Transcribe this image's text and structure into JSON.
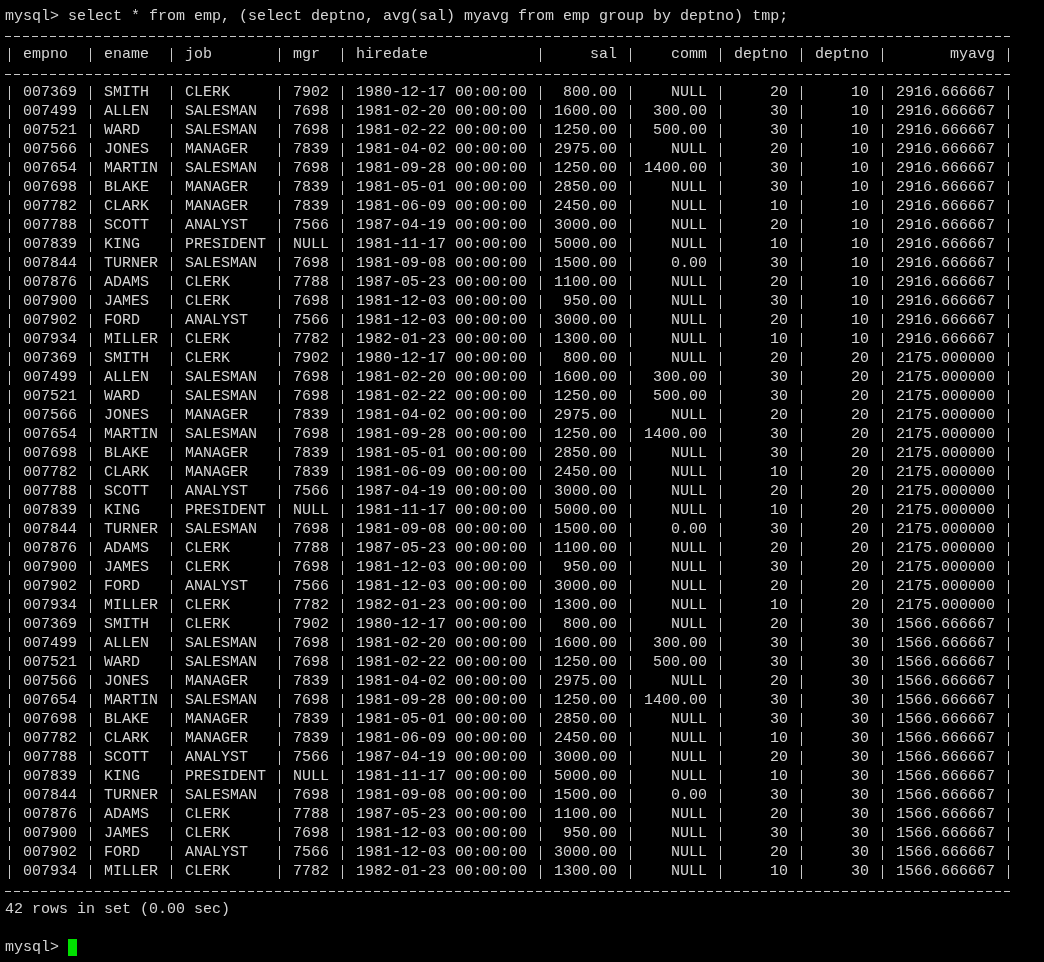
{
  "command": {
    "prompt": "mysql>",
    "text": "select * from emp, (select deptno, avg(sal) myavg from emp group by deptno) tmp;"
  },
  "table": {
    "columns": [
      {
        "label": "empno"
      },
      {
        "label": "ename"
      },
      {
        "label": "job"
      },
      {
        "label": "mgr"
      },
      {
        "label": "hiredate"
      },
      {
        "label": "sal"
      },
      {
        "label": "comm"
      },
      {
        "label": "deptno"
      },
      {
        "label": "deptno"
      },
      {
        "label": "myavg"
      }
    ],
    "rows": [
      [
        "007369",
        "SMITH",
        "CLERK",
        "7902",
        "1980-12-17 00:00:00",
        "800.00",
        "NULL",
        "20",
        "10",
        "2916.666667"
      ],
      [
        "007499",
        "ALLEN",
        "SALESMAN",
        "7698",
        "1981-02-20 00:00:00",
        "1600.00",
        "300.00",
        "30",
        "10",
        "2916.666667"
      ],
      [
        "007521",
        "WARD",
        "SALESMAN",
        "7698",
        "1981-02-22 00:00:00",
        "1250.00",
        "500.00",
        "30",
        "10",
        "2916.666667"
      ],
      [
        "007566",
        "JONES",
        "MANAGER",
        "7839",
        "1981-04-02 00:00:00",
        "2975.00",
        "NULL",
        "20",
        "10",
        "2916.666667"
      ],
      [
        "007654",
        "MARTIN",
        "SALESMAN",
        "7698",
        "1981-09-28 00:00:00",
        "1250.00",
        "1400.00",
        "30",
        "10",
        "2916.666667"
      ],
      [
        "007698",
        "BLAKE",
        "MANAGER",
        "7839",
        "1981-05-01 00:00:00",
        "2850.00",
        "NULL",
        "30",
        "10",
        "2916.666667"
      ],
      [
        "007782",
        "CLARK",
        "MANAGER",
        "7839",
        "1981-06-09 00:00:00",
        "2450.00",
        "NULL",
        "10",
        "10",
        "2916.666667"
      ],
      [
        "007788",
        "SCOTT",
        "ANALYST",
        "7566",
        "1987-04-19 00:00:00",
        "3000.00",
        "NULL",
        "20",
        "10",
        "2916.666667"
      ],
      [
        "007839",
        "KING",
        "PRESIDENT",
        "NULL",
        "1981-11-17 00:00:00",
        "5000.00",
        "NULL",
        "10",
        "10",
        "2916.666667"
      ],
      [
        "007844",
        "TURNER",
        "SALESMAN",
        "7698",
        "1981-09-08 00:00:00",
        "1500.00",
        "0.00",
        "30",
        "10",
        "2916.666667"
      ],
      [
        "007876",
        "ADAMS",
        "CLERK",
        "7788",
        "1987-05-23 00:00:00",
        "1100.00",
        "NULL",
        "20",
        "10",
        "2916.666667"
      ],
      [
        "007900",
        "JAMES",
        "CLERK",
        "7698",
        "1981-12-03 00:00:00",
        "950.00",
        "NULL",
        "30",
        "10",
        "2916.666667"
      ],
      [
        "007902",
        "FORD",
        "ANALYST",
        "7566",
        "1981-12-03 00:00:00",
        "3000.00",
        "NULL",
        "20",
        "10",
        "2916.666667"
      ],
      [
        "007934",
        "MILLER",
        "CLERK",
        "7782",
        "1982-01-23 00:00:00",
        "1300.00",
        "NULL",
        "10",
        "10",
        "2916.666667"
      ],
      [
        "007369",
        "SMITH",
        "CLERK",
        "7902",
        "1980-12-17 00:00:00",
        "800.00",
        "NULL",
        "20",
        "20",
        "2175.000000"
      ],
      [
        "007499",
        "ALLEN",
        "SALESMAN",
        "7698",
        "1981-02-20 00:00:00",
        "1600.00",
        "300.00",
        "30",
        "20",
        "2175.000000"
      ],
      [
        "007521",
        "WARD",
        "SALESMAN",
        "7698",
        "1981-02-22 00:00:00",
        "1250.00",
        "500.00",
        "30",
        "20",
        "2175.000000"
      ],
      [
        "007566",
        "JONES",
        "MANAGER",
        "7839",
        "1981-04-02 00:00:00",
        "2975.00",
        "NULL",
        "20",
        "20",
        "2175.000000"
      ],
      [
        "007654",
        "MARTIN",
        "SALESMAN",
        "7698",
        "1981-09-28 00:00:00",
        "1250.00",
        "1400.00",
        "30",
        "20",
        "2175.000000"
      ],
      [
        "007698",
        "BLAKE",
        "MANAGER",
        "7839",
        "1981-05-01 00:00:00",
        "2850.00",
        "NULL",
        "30",
        "20",
        "2175.000000"
      ],
      [
        "007782",
        "CLARK",
        "MANAGER",
        "7839",
        "1981-06-09 00:00:00",
        "2450.00",
        "NULL",
        "10",
        "20",
        "2175.000000"
      ],
      [
        "007788",
        "SCOTT",
        "ANALYST",
        "7566",
        "1987-04-19 00:00:00",
        "3000.00",
        "NULL",
        "20",
        "20",
        "2175.000000"
      ],
      [
        "007839",
        "KING",
        "PRESIDENT",
        "NULL",
        "1981-11-17 00:00:00",
        "5000.00",
        "NULL",
        "10",
        "20",
        "2175.000000"
      ],
      [
        "007844",
        "TURNER",
        "SALESMAN",
        "7698",
        "1981-09-08 00:00:00",
        "1500.00",
        "0.00",
        "30",
        "20",
        "2175.000000"
      ],
      [
        "007876",
        "ADAMS",
        "CLERK",
        "7788",
        "1987-05-23 00:00:00",
        "1100.00",
        "NULL",
        "20",
        "20",
        "2175.000000"
      ],
      [
        "007900",
        "JAMES",
        "CLERK",
        "7698",
        "1981-12-03 00:00:00",
        "950.00",
        "NULL",
        "30",
        "20",
        "2175.000000"
      ],
      [
        "007902",
        "FORD",
        "ANALYST",
        "7566",
        "1981-12-03 00:00:00",
        "3000.00",
        "NULL",
        "20",
        "20",
        "2175.000000"
      ],
      [
        "007934",
        "MILLER",
        "CLERK",
        "7782",
        "1982-01-23 00:00:00",
        "1300.00",
        "NULL",
        "10",
        "20",
        "2175.000000"
      ],
      [
        "007369",
        "SMITH",
        "CLERK",
        "7902",
        "1980-12-17 00:00:00",
        "800.00",
        "NULL",
        "20",
        "30",
        "1566.666667"
      ],
      [
        "007499",
        "ALLEN",
        "SALESMAN",
        "7698",
        "1981-02-20 00:00:00",
        "1600.00",
        "300.00",
        "30",
        "30",
        "1566.666667"
      ],
      [
        "007521",
        "WARD",
        "SALESMAN",
        "7698",
        "1981-02-22 00:00:00",
        "1250.00",
        "500.00",
        "30",
        "30",
        "1566.666667"
      ],
      [
        "007566",
        "JONES",
        "MANAGER",
        "7839",
        "1981-04-02 00:00:00",
        "2975.00",
        "NULL",
        "20",
        "30",
        "1566.666667"
      ],
      [
        "007654",
        "MARTIN",
        "SALESMAN",
        "7698",
        "1981-09-28 00:00:00",
        "1250.00",
        "1400.00",
        "30",
        "30",
        "1566.666667"
      ],
      [
        "007698",
        "BLAKE",
        "MANAGER",
        "7839",
        "1981-05-01 00:00:00",
        "2850.00",
        "NULL",
        "30",
        "30",
        "1566.666667"
      ],
      [
        "007782",
        "CLARK",
        "MANAGER",
        "7839",
        "1981-06-09 00:00:00",
        "2450.00",
        "NULL",
        "10",
        "30",
        "1566.666667"
      ],
      [
        "007788",
        "SCOTT",
        "ANALYST",
        "7566",
        "1987-04-19 00:00:00",
        "3000.00",
        "NULL",
        "20",
        "30",
        "1566.666667"
      ],
      [
        "007839",
        "KING",
        "PRESIDENT",
        "NULL",
        "1981-11-17 00:00:00",
        "5000.00",
        "NULL",
        "10",
        "30",
        "1566.666667"
      ],
      [
        "007844",
        "TURNER",
        "SALESMAN",
        "7698",
        "1981-09-08 00:00:00",
        "1500.00",
        "0.00",
        "30",
        "30",
        "1566.666667"
      ],
      [
        "007876",
        "ADAMS",
        "CLERK",
        "7788",
        "1987-05-23 00:00:00",
        "1100.00",
        "NULL",
        "20",
        "30",
        "1566.666667"
      ],
      [
        "007900",
        "JAMES",
        "CLERK",
        "7698",
        "1981-12-03 00:00:00",
        "950.00",
        "NULL",
        "30",
        "30",
        "1566.666667"
      ],
      [
        "007902",
        "FORD",
        "ANALYST",
        "7566",
        "1981-12-03 00:00:00",
        "3000.00",
        "NULL",
        "20",
        "30",
        "1566.666667"
      ],
      [
        "007934",
        "MILLER",
        "CLERK",
        "7782",
        "1982-01-23 00:00:00",
        "1300.00",
        "NULL",
        "10",
        "30",
        "1566.666667"
      ]
    ]
  },
  "footer": "42 rows in set (0.00 sec)",
  "prompt": "mysql>"
}
